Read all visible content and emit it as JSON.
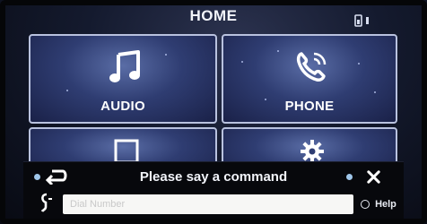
{
  "header": {
    "title": "HOME"
  },
  "tiles": [
    {
      "label": "AUDIO",
      "icon": "music-note-icon"
    },
    {
      "label": "PHONE",
      "icon": "phone-icon"
    },
    {
      "label": "",
      "icon": "square-icon"
    },
    {
      "label": "",
      "icon": "gear-icon"
    }
  ],
  "voice_bar": {
    "prompt": "Please say a command",
    "input_placeholder": "Dial Number",
    "help_label": "Help",
    "back_icon": "back-arrow-icon",
    "close_icon": "close-icon",
    "voice_icon": "voice-command-icon"
  },
  "colors": {
    "tile_border": "#b9c2df",
    "tile_fill": "#2f3d72",
    "bar_bg": "#07080c"
  }
}
